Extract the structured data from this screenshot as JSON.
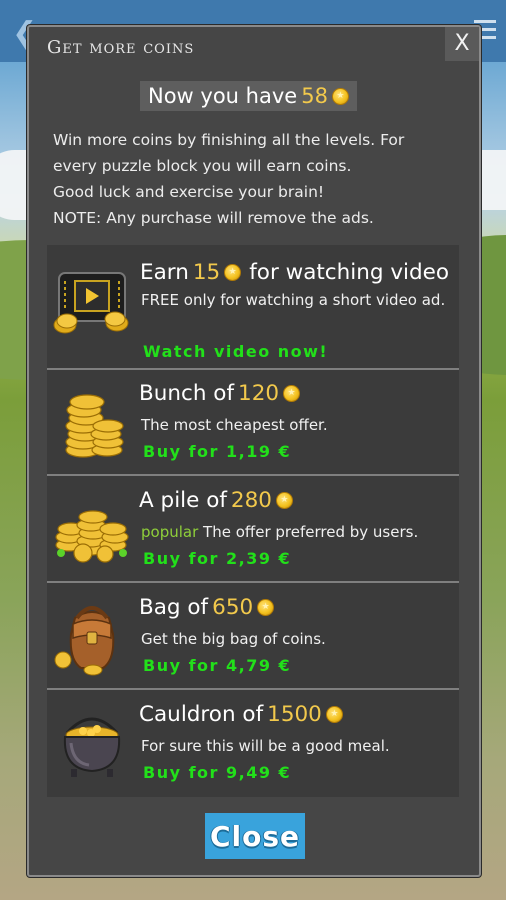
{
  "dialog": {
    "title": "Get more coins",
    "close_x": "X",
    "have_label": "Now you have",
    "have_value": "58",
    "description_lines": [
      "Win more coins by finishing all the levels. For",
      "every puzzle block you will earn coins.",
      "Good luck and exercise your brain!",
      "NOTE: Any purchase will remove the ads."
    ],
    "close_button": "Close"
  },
  "offers": [
    {
      "prefix": "Earn",
      "amount": "15",
      "suffix": "for watching video",
      "description": "FREE only for watching a short video ad.",
      "popular": "",
      "action": "Watch video now!",
      "icon": "video-coins-icon"
    },
    {
      "prefix": "Bunch of",
      "amount": "120",
      "suffix": "",
      "description": "The most cheapest offer.",
      "popular": "",
      "action": "Buy for 1,19 €",
      "icon": "coin-stack-icon"
    },
    {
      "prefix": "A pile of",
      "amount": "280",
      "suffix": "",
      "description": "The offer preferred by users.",
      "popular": "popular",
      "action": "Buy for 2,39 €",
      "icon": "coin-pile-icon"
    },
    {
      "prefix": "Bag of",
      "amount": "650",
      "suffix": "",
      "description": "Get the big bag of coins.",
      "popular": "",
      "action": "Buy for 4,79 €",
      "icon": "coin-bag-icon"
    },
    {
      "prefix": "Cauldron of",
      "amount": "1500",
      "suffix": "",
      "description": "For sure this will be a good meal.",
      "popular": "",
      "action": "Buy for 9,49 €",
      "icon": "cauldron-icon"
    }
  ],
  "colors": {
    "dialog_bg": "#464646",
    "panel_bg": "#3b3b3b",
    "gold_text": "#f2c94c",
    "action_green": "#22e01a",
    "close_button": "#39a3dc"
  }
}
